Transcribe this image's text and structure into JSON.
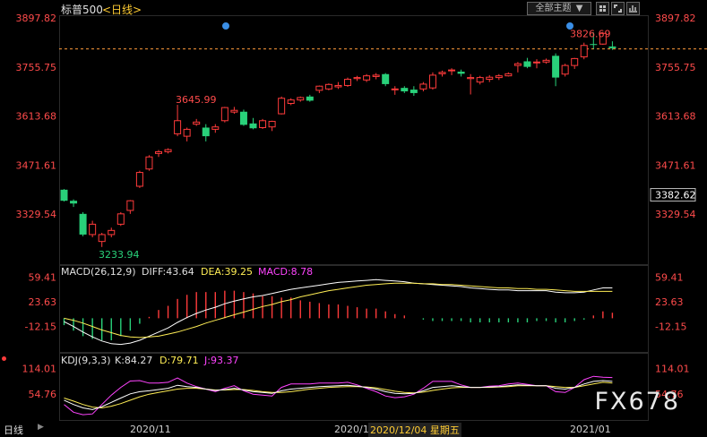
{
  "header": {
    "symbol": "标普500",
    "period": "<日线>",
    "theme_menu": "全部主题",
    "menu_arrow": "▼"
  },
  "price_chart": {
    "high_label": "3826.69",
    "low_label": "3233.94",
    "left_high_label": "3645.99",
    "axis_ticks": [
      "3897.82",
      "3755.75",
      "3613.68",
      "3471.61",
      "3329.54"
    ],
    "axis_ticks_value": [
      3897.82,
      3755.75,
      3613.68,
      3471.61,
      3329.54
    ],
    "last_price_label": "3382.62",
    "dashed_level": 3808,
    "colors": {
      "up": "#ff3b3b",
      "down": "#29d17a",
      "dashed": "#ff9a3c"
    }
  },
  "macd": {
    "label": "MACD(26,12,9)",
    "diff": "DIFF:43.64",
    "dea": "DEA:39.25",
    "macd": "MACD:8.78",
    "axis_ticks": [
      "59.41",
      "23.63",
      "-12.15"
    ]
  },
  "kdj": {
    "label": "KDJ(9,3,3)",
    "k": "K:84.27",
    "d": "D:79.71",
    "j": "J:93.37",
    "axis_ticks": [
      "114.01",
      "54.76"
    ]
  },
  "xaxis": {
    "period_label": "日线",
    "labels": [
      "2020/11",
      "2020/1",
      "2020/12/04 星期五",
      "2021/01"
    ]
  },
  "watermark": "FX678",
  "chart_data": {
    "type": "candlestick",
    "candles": [
      [
        3400,
        3402,
        3366,
        3368
      ],
      [
        3368,
        3372,
        3350,
        3360
      ],
      [
        3330,
        3335,
        3265,
        3270
      ],
      [
        3270,
        3310,
        3262,
        3300
      ],
      [
        3250,
        3275,
        3234,
        3270
      ],
      [
        3270,
        3290,
        3262,
        3282
      ],
      [
        3300,
        3335,
        3295,
        3330
      ],
      [
        3340,
        3370,
        3330,
        3368
      ],
      [
        3410,
        3455,
        3405,
        3450
      ],
      [
        3460,
        3500,
        3455,
        3495
      ],
      [
        3505,
        3515,
        3495,
        3510
      ],
      [
        3510,
        3520,
        3505,
        3516
      ],
      [
        3562,
        3646,
        3555,
        3600
      ],
      [
        3555,
        3580,
        3540,
        3575
      ],
      [
        3590,
        3605,
        3585,
        3596
      ],
      [
        3580,
        3590,
        3540,
        3555
      ],
      [
        3575,
        3590,
        3565,
        3582
      ],
      [
        3600,
        3640,
        3595,
        3638
      ],
      [
        3625,
        3640,
        3620,
        3630
      ],
      [
        3626,
        3632,
        3585,
        3588
      ],
      [
        3592,
        3608,
        3575,
        3578
      ],
      [
        3580,
        3605,
        3576,
        3600
      ],
      [
        3582,
        3600,
        3570,
        3598
      ],
      [
        3620,
        3670,
        3618,
        3665
      ],
      [
        3650,
        3665,
        3645,
        3660
      ],
      [
        3660,
        3670,
        3655,
        3667
      ],
      [
        3670,
        3675,
        3655,
        3658
      ],
      [
        3688,
        3702,
        3680,
        3700
      ],
      [
        3692,
        3708,
        3688,
        3705
      ],
      [
        3698,
        3712,
        3692,
        3702
      ],
      [
        3702,
        3725,
        3698,
        3720
      ],
      [
        3722,
        3730,
        3715,
        3725
      ],
      [
        3718,
        3735,
        3712,
        3730
      ],
      [
        3728,
        3738,
        3720,
        3732
      ],
      [
        3735,
        3738,
        3700,
        3706
      ],
      [
        3690,
        3700,
        3675,
        3692
      ],
      [
        3695,
        3700,
        3680,
        3685
      ],
      [
        3690,
        3700,
        3672,
        3680
      ],
      [
        3692,
        3712,
        3685,
        3706
      ],
      [
        3695,
        3740,
        3690,
        3732
      ],
      [
        3736,
        3745,
        3728,
        3740
      ],
      [
        3745,
        3752,
        3732,
        3747
      ],
      [
        3742,
        3748,
        3728,
        3736
      ],
      [
        3722,
        3735,
        3676,
        3725
      ],
      [
        3712,
        3730,
        3705,
        3725
      ],
      [
        3720,
        3732,
        3712,
        3726
      ],
      [
        3725,
        3735,
        3718,
        3730
      ],
      [
        3730,
        3740,
        3728,
        3736
      ],
      [
        3760,
        3770,
        3740,
        3765
      ],
      [
        3772,
        3782,
        3752,
        3756
      ],
      [
        3770,
        3778,
        3752,
        3770
      ],
      [
        3770,
        3780,
        3765,
        3775
      ],
      [
        3788,
        3795,
        3700,
        3725
      ],
      [
        3735,
        3765,
        3728,
        3760
      ],
      [
        3760,
        3782,
        3750,
        3780
      ],
      [
        3785,
        3826,
        3778,
        3818
      ],
      [
        3822,
        3856,
        3808,
        3820
      ],
      [
        3822,
        3857,
        3820,
        3853
      ],
      [
        3815,
        3830,
        3805,
        3810
      ]
    ],
    "macd": {
      "range": [
        -45,
        72
      ],
      "dif": [
        -5,
        -12,
        -20,
        -27,
        -33,
        -37,
        -38,
        -36,
        -32,
        -26,
        -20,
        -14,
        -6,
        1,
        7,
        12,
        16,
        21,
        25,
        28,
        31,
        33,
        36,
        39,
        42,
        44,
        46,
        48,
        50,
        52,
        53,
        54,
        55,
        56,
        55,
        54,
        53,
        51,
        50,
        49,
        48,
        47,
        46,
        44,
        43,
        42,
        41,
        41,
        40,
        40,
        40,
        40,
        38,
        37,
        37,
        38,
        41,
        44,
        44
      ],
      "dea": [
        0,
        -3,
        -7,
        -12,
        -17,
        -21,
        -25,
        -27,
        -28,
        -27,
        -26,
        -23,
        -20,
        -16,
        -12,
        -7,
        -3,
        1,
        5,
        9,
        13,
        17,
        20,
        24,
        27,
        31,
        34,
        37,
        40,
        42,
        44,
        46,
        48,
        49,
        50,
        51,
        51,
        51,
        50,
        50,
        49,
        49,
        48,
        47,
        46,
        45,
        44,
        44,
        43,
        43,
        42,
        42,
        41,
        40,
        39,
        39,
        39,
        39,
        39
      ],
      "hist": [
        -10,
        -18,
        -26,
        -30,
        -32,
        -32,
        -26,
        -18,
        -8,
        2,
        12,
        18,
        28,
        34,
        38,
        38,
        38,
        40,
        40,
        38,
        36,
        32,
        32,
        30,
        30,
        26,
        24,
        22,
        20,
        20,
        18,
        16,
        14,
        14,
        10,
        6,
        4,
        0,
        -2,
        -4,
        -4,
        -4,
        -4,
        -6,
        -6,
        -6,
        -6,
        -6,
        -6,
        -6,
        -4,
        -4,
        -6,
        -6,
        -4,
        -2,
        4,
        10,
        8
      ]
    },
    "kdj": {
      "range": [
        0,
        130
      ],
      "k": [
        40,
        30,
        22,
        18,
        25,
        35,
        45,
        55,
        60,
        62,
        65,
        68,
        75,
        72,
        70,
        66,
        63,
        65,
        68,
        64,
        60,
        58,
        56,
        62,
        66,
        68,
        70,
        72,
        73,
        74,
        75,
        73,
        70,
        66,
        60,
        56,
        55,
        56,
        62,
        70,
        72,
        74,
        72,
        70,
        70,
        71,
        72,
        74,
        76,
        75,
        74,
        74,
        68,
        66,
        70,
        78,
        84,
        86,
        84
      ],
      "d": [
        45,
        38,
        30,
        24,
        22,
        26,
        32,
        40,
        48,
        54,
        58,
        62,
        66,
        68,
        68,
        66,
        64,
        64,
        65,
        65,
        63,
        60,
        58,
        58,
        60,
        63,
        66,
        68,
        70,
        71,
        72,
        72,
        71,
        69,
        65,
        61,
        58,
        57,
        59,
        63,
        66,
        69,
        70,
        70,
        70,
        70,
        71,
        72,
        74,
        74,
        74,
        74,
        72,
        70,
        70,
        74,
        78,
        82,
        80
      ],
      "j": [
        30,
        12,
        6,
        8,
        30,
        52,
        70,
        85,
        86,
        80,
        80,
        82,
        92,
        80,
        72,
        66,
        60,
        68,
        74,
        62,
        54,
        52,
        50,
        70,
        78,
        78,
        78,
        80,
        80,
        80,
        82,
        76,
        68,
        60,
        50,
        46,
        48,
        54,
        68,
        84,
        84,
        84,
        76,
        70,
        70,
        73,
        74,
        78,
        80,
        77,
        74,
        74,
        60,
        58,
        70,
        88,
        96,
        94,
        93
      ]
    }
  }
}
